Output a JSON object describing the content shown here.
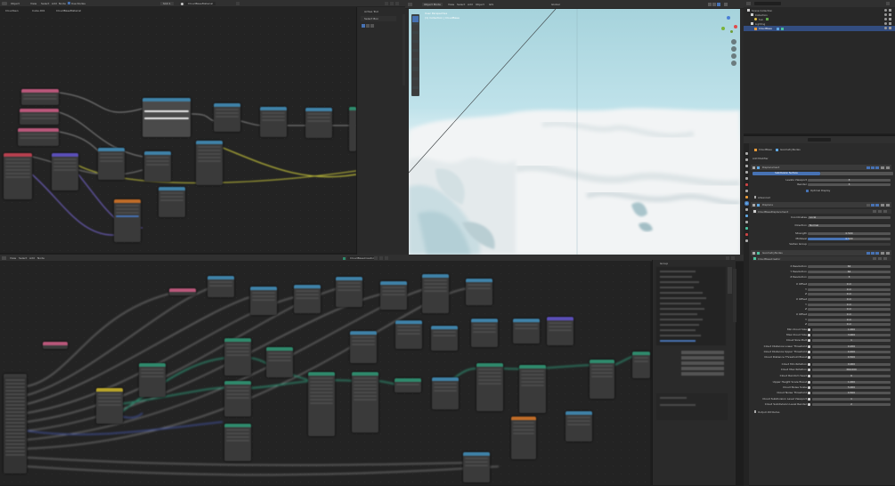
{
  "topbar": {
    "mode": "Object",
    "menus": [
      "View",
      "Select",
      "Add",
      "Node"
    ],
    "use_nodes": "Use Nodes",
    "slot": "Slot 1",
    "material": "CloudBaseMaterial",
    "viewport_mode": "Object Mode",
    "viewport_menus": [
      "View",
      "Select",
      "Add",
      "Object",
      "GIS"
    ],
    "shading": "Global"
  },
  "shader_editor": {
    "breadcrumb": [
      "CloudGen",
      "Cube.001",
      "CloudBaseMaterial"
    ],
    "nodes": [
      {
        "name": "node-pink-a",
        "color": "#b9577a"
      },
      {
        "name": "node-pink-b",
        "color": "#b9577a"
      },
      {
        "name": "node-pink-c",
        "color": "#b9577a"
      },
      {
        "name": "node-pink-d",
        "color": "#b9577a"
      },
      {
        "name": "node-red-a",
        "color": "#b7404f"
      },
      {
        "name": "node-blue-a",
        "color": "#3f82a8"
      },
      {
        "name": "node-blue-b",
        "color": "#3f82a8"
      },
      {
        "name": "node-blue-c",
        "color": "#3f82a8"
      },
      {
        "name": "node-blue-d",
        "color": "#3f82a8"
      },
      {
        "name": "node-blue-e",
        "color": "#3f82a8"
      },
      {
        "name": "node-blue-f",
        "color": "#3f82a8"
      },
      {
        "name": "node-blue-g",
        "color": "#3f82a8"
      },
      {
        "name": "node-purple-a",
        "color": "#5b4fb8"
      },
      {
        "name": "node-orange-a",
        "color": "#c06c28"
      },
      {
        "name": "node-green-a",
        "color": "#2f8a6c"
      }
    ],
    "sidebar": {
      "title": "Active Tool",
      "item": "Select Box"
    }
  },
  "viewport": {
    "title": "User Perspective",
    "subtitle": "(1) Collection | CloudBase",
    "gizmo": [
      "X",
      "Y",
      "Z"
    ],
    "tools": [
      "select-box-icon",
      "cursor-icon",
      "move-icon",
      "rotate-icon",
      "scale-icon",
      "transform-icon",
      "annotate-icon",
      "measure-icon",
      "add-cube-icon"
    ]
  },
  "geometry_editor": {
    "breadcrumb": [
      "CloudGen",
      "GeometryNodes",
      "CloudBaseCreator"
    ],
    "menus": [
      "View",
      "Select",
      "Add",
      "Node"
    ],
    "tree": "CloudBaseCreator",
    "group": {
      "title": "Group"
    }
  },
  "outliner": {
    "title": "Scene Collection",
    "items": [
      "Collection",
      "Sun",
      "Lighting",
      "CloudBase"
    ]
  },
  "properties": {
    "breadcrumb": [
      "CloudBase",
      "GeometryNodes"
    ],
    "add_modifier": "Add Modifier",
    "modifiers": [
      {
        "name": "Displacement",
        "label": "Subdivision Surface"
      },
      {
        "name": "Displace"
      },
      {
        "name": "GeometryNodes"
      }
    ],
    "subdiv": [
      {
        "label": "Levels Viewport",
        "value": "3"
      },
      {
        "label": "Render",
        "value": "3"
      }
    ],
    "subdiv_check": "Optimal Display",
    "advanced": "Advanced",
    "displace_texture": "CloudBaseDisplacement",
    "displace_fields": [
      {
        "label": "Coordinates",
        "value": "Local"
      },
      {
        "label": "Direction",
        "value": "Normal"
      },
      {
        "label": "Strength",
        "value": "0.500"
      },
      {
        "label": "Midlevel",
        "value": "0.500"
      },
      {
        "label": "Vertex Group",
        "value": ""
      }
    ],
    "geometry_nodes": "CloudBaseCreator",
    "gn_fields": [
      {
        "label": "X Resolution",
        "value": "64",
        "icon": false
      },
      {
        "label": "Y Resolution",
        "value": "64",
        "icon": false
      },
      {
        "label": "Z Resolution",
        "value": "3",
        "icon": false
      },
      {
        "label": "X Offset",
        "value": "0 m",
        "icon": false
      },
      {
        "label": "Y",
        "value": "0 m",
        "icon": false
      },
      {
        "label": "Z",
        "value": "0 m",
        "icon": false
      },
      {
        "label": "X Offset",
        "value": "0 m",
        "icon": false
      },
      {
        "label": "Y",
        "value": "0 m",
        "icon": false
      },
      {
        "label": "Z",
        "value": "0 m",
        "icon": false
      },
      {
        "label": "X Offset",
        "value": "0 m",
        "icon": false
      },
      {
        "label": "Y",
        "value": "0 m",
        "icon": false
      },
      {
        "label": "Z",
        "value": "0 m",
        "icon": false
      },
      {
        "label": "Min Cloud Size",
        "value": "1.000",
        "icon": true
      },
      {
        "label": "Max Cloud Size",
        "value": "3.000",
        "icon": true
      },
      {
        "label": "Cloud Size Mult",
        "value": "1",
        "icon": true
      },
      {
        "label": "Cloud Distance Lower Threshold",
        "value": "0.200",
        "icon": true
      },
      {
        "label": "Cloud Distance Upper Threshold",
        "value": "0.400",
        "icon": true
      },
      {
        "label": "Cloud Distance Threshold Boost",
        "value": "0.500",
        "icon": true
      },
      {
        "label": "Cloud Min Rotation",
        "value": "0.000",
        "icon": true
      },
      {
        "label": "Cloud Max Rotation",
        "value": "360.000",
        "icon": true
      },
      {
        "label": "Cloud Random Seed",
        "value": "0",
        "icon": true
      },
      {
        "label": "Upper Height Scale Boost",
        "value": "1.000",
        "icon": true
      },
      {
        "label": "Cloud Noise Scale",
        "value": "5.000",
        "icon": true
      },
      {
        "label": "Cloud Noise Threshold",
        "value": "0.500",
        "icon": true
      },
      {
        "label": "Cloud Subdivision Level Viewport",
        "value": "1",
        "icon": true
      },
      {
        "label": "Cloud Subdivision Level Render",
        "value": "2",
        "icon": true
      }
    ],
    "output_attributes": "Output Attributes"
  },
  "colors": {
    "accent": "#4772b3",
    "sky_top": "#9fcfd8",
    "sky_bottom": "#cfe8ef",
    "cloud": "#f2f4f5"
  }
}
